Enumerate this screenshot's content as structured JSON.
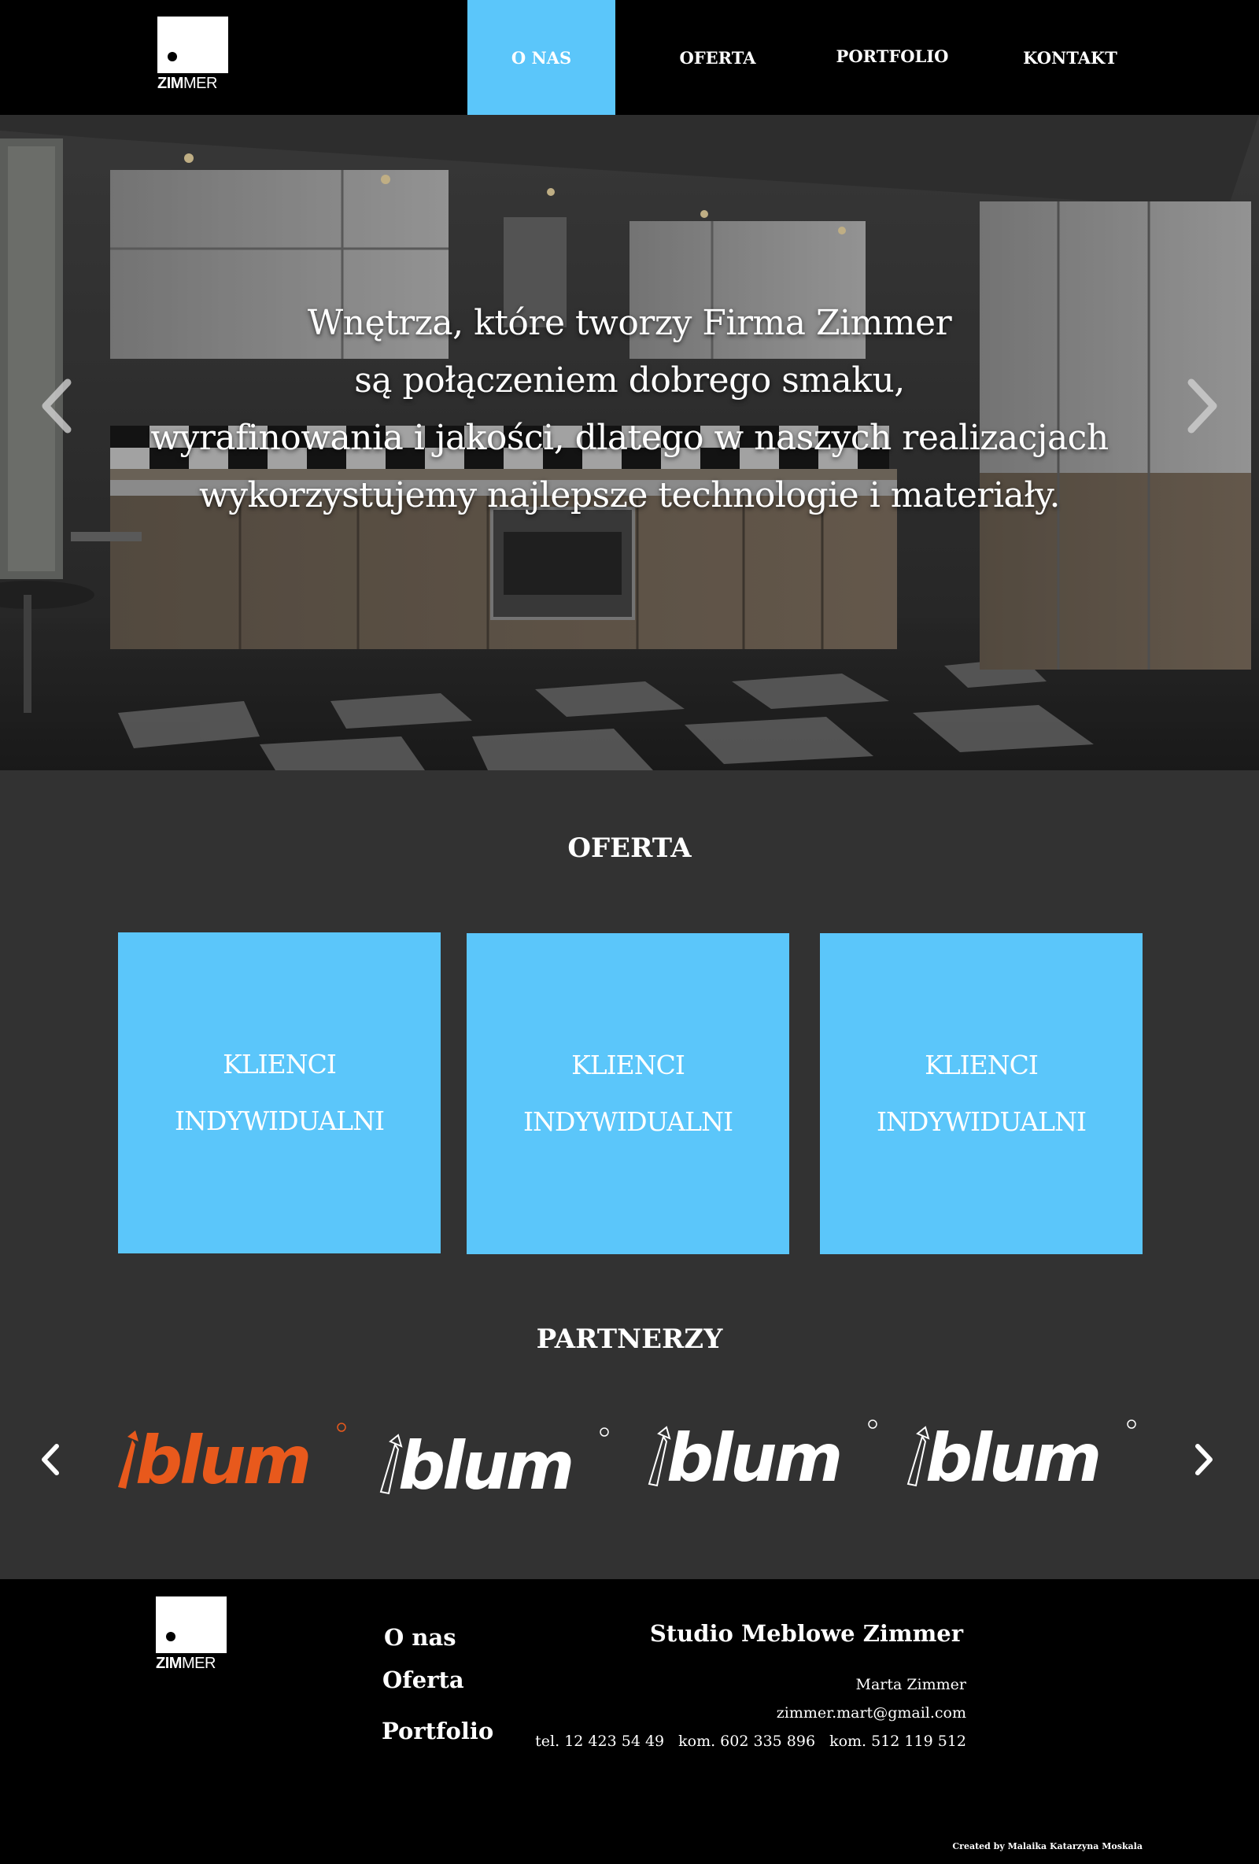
{
  "brand": {
    "logo_text_bold": "ZIM",
    "logo_text_light": "MER"
  },
  "nav": {
    "items": [
      {
        "label": "O NAS",
        "active": true
      },
      {
        "label": "OFERTA",
        "active": false
      },
      {
        "label": "PORTFOLIO",
        "active": false
      },
      {
        "label": "KONTAKT",
        "active": false
      }
    ]
  },
  "hero": {
    "lines": [
      "Wnętrza, które tworzy Firma Zimmer",
      "są połączeniem dobrego smaku,",
      "wyrafinowania i jakości, dlatego w naszych realizacjach",
      "wykorzystujemy najlepsze technologie i materiały."
    ],
    "prev_icon": "chevron-left-icon",
    "next_icon": "chevron-right-icon"
  },
  "offer": {
    "title": "OFERTA",
    "cards": [
      {
        "line1": "KLIENCI",
        "line2": "INDYWIDUALNI"
      },
      {
        "line1": "KLIENCI",
        "line2": "INDYWIDUALNI"
      },
      {
        "line1": "KLIENCI",
        "line2": "INDYWIDUALNI"
      }
    ]
  },
  "partners": {
    "title": "PARTNERZY",
    "logos": [
      {
        "name": "blum",
        "color": "#e8591c"
      },
      {
        "name": "blum",
        "color": "#ffffff"
      },
      {
        "name": "blum",
        "color": "#ffffff"
      },
      {
        "name": "blum",
        "color": "#ffffff"
      }
    ]
  },
  "footer": {
    "links": [
      "O nas",
      "Oferta",
      "Portfolio"
    ],
    "studio": "Studio Meblowe Zimmer",
    "person": "Marta Zimmer",
    "email": "zimmer.mart@gmail.com",
    "phones": [
      "tel. 12 423 54 49",
      "kom. 602 335 896",
      "kom. 512 119 512"
    ],
    "credit": "Created by Malaika Katarzyna Moskala"
  },
  "colors": {
    "accent": "#5bc6fa",
    "background": "#323232",
    "header": "#000000"
  }
}
